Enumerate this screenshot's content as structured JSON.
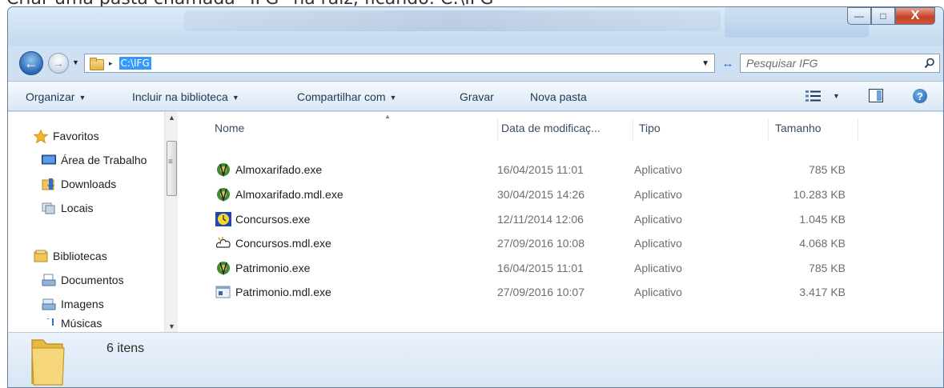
{
  "caption": "Criar uma pasta chamada “IFG” na raiz, ficando: C:\\IFG",
  "window": {
    "minimize_symbol": "—",
    "maximize_symbol": "□",
    "close_symbol": "X"
  },
  "address": {
    "path": "C:\\IFG",
    "back_symbol": "←",
    "forward_symbol": "→",
    "history_symbol": "▼",
    "separator": "▸",
    "dropdown_symbol": "▼",
    "refresh_symbol": "↔"
  },
  "search": {
    "placeholder": "Pesquisar IFG"
  },
  "toolbar": {
    "organize": "Organizar",
    "include_library": "Incluir na biblioteca",
    "share_with": "Compartilhar com",
    "burn": "Gravar",
    "new_folder": "Nova pasta",
    "dropdown_arrow": "▼",
    "help_symbol": "?"
  },
  "nav": {
    "favorites": "Favoritos",
    "desktop": "Área de Trabalho",
    "downloads": "Downloads",
    "places": "Locais",
    "libraries": "Bibliotecas",
    "documents": "Documentos",
    "images": "Imagens",
    "music": "Músicas",
    "scroll_up": "▲",
    "scroll_down": "▼"
  },
  "columns": {
    "name": "Nome",
    "date": "Data de modificaç...",
    "type": "Tipo",
    "size": "Tamanho",
    "sort_indicator": "▲"
  },
  "files": [
    {
      "name": "Almoxarifado.exe",
      "date": "16/04/2015 11:01",
      "type": "Aplicativo",
      "size": "785 KB",
      "icon": "green-figure-icon"
    },
    {
      "name": "Almoxarifado.mdl.exe",
      "date": "30/04/2015 14:26",
      "type": "Aplicativo",
      "size": "10.283 KB",
      "icon": "green-figure-icon"
    },
    {
      "name": "Concursos.exe",
      "date": "12/11/2014 12:06",
      "type": "Aplicativo",
      "size": "1.045 KB",
      "icon": "yellow-clock-icon"
    },
    {
      "name": "Concursos.mdl.exe",
      "date": "27/09/2016 10:08",
      "type": "Aplicativo",
      "size": "4.068 KB",
      "icon": "cloud-sketch-icon"
    },
    {
      "name": "Patrimonio.exe",
      "date": "16/04/2015 11:01",
      "type": "Aplicativo",
      "size": "785 KB",
      "icon": "green-figure-icon"
    },
    {
      "name": "Patrimonio.mdl.exe",
      "date": "27/09/2016 10:07",
      "type": "Aplicativo",
      "size": "3.417 KB",
      "icon": "generic-app-icon"
    }
  ],
  "status": {
    "item_count": "6 itens"
  },
  "colors": {
    "selection_blue": "#3399ff",
    "toolbar_text": "#1e3955",
    "header_text": "#3b4c63",
    "secondary_text": "#6d6d6d",
    "close_red": "#c4432a"
  }
}
